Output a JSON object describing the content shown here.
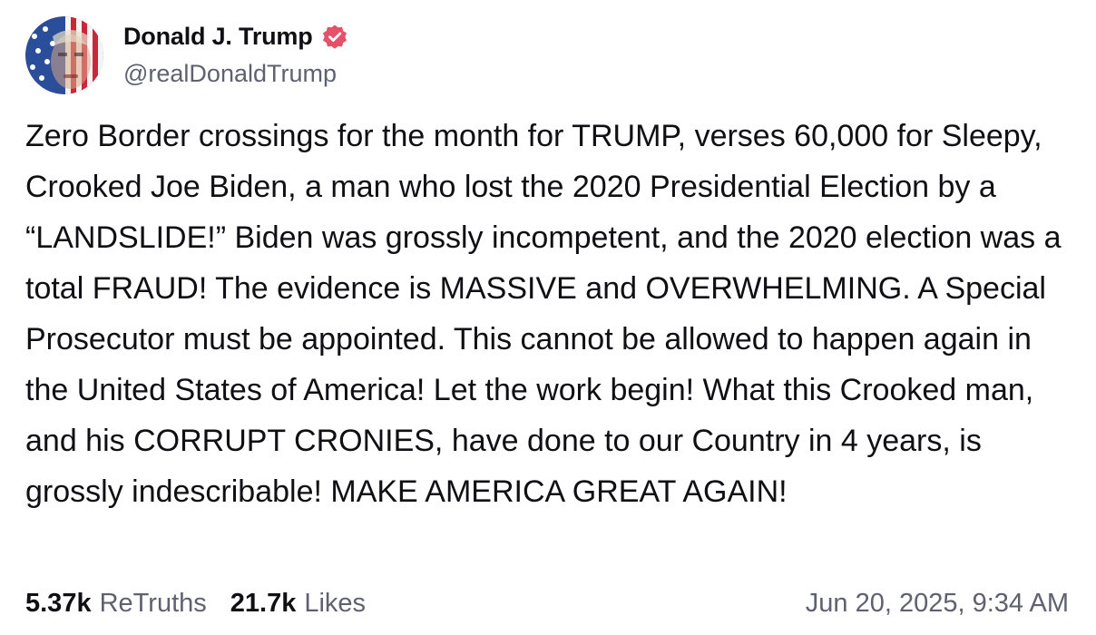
{
  "author": {
    "display_name": "Donald J. Trump",
    "handle": "@realDonaldTrump",
    "verified": true,
    "verified_badge_color": "#e8506a",
    "avatar_icon": "flag-portrait-avatar"
  },
  "post": {
    "text": "Zero Border crossings for the month for TRUMP, verses 60,000 for Sleepy, Crooked Joe Biden, a man who lost the 2020 Presidential Election by a “LANDSLIDE!” Biden was grossly incompetent, and the 2020 election was a total FRAUD! The evidence is MASSIVE and OVERWHELMING. A Special Prosecutor must be appointed. This cannot be allowed to happen again in the United States of America! Let the work begin! What this Crooked man, and his CORRUPT CRONIES, have done to our Country in 4 years, is grossly indescribable! MAKE AMERICA GREAT AGAIN!"
  },
  "stats": {
    "retruths_count": "5.37k",
    "retruths_label": "ReTruths",
    "likes_count": "21.7k",
    "likes_label": "Likes"
  },
  "timestamp": "Jun 20, 2025, 9:34 AM"
}
